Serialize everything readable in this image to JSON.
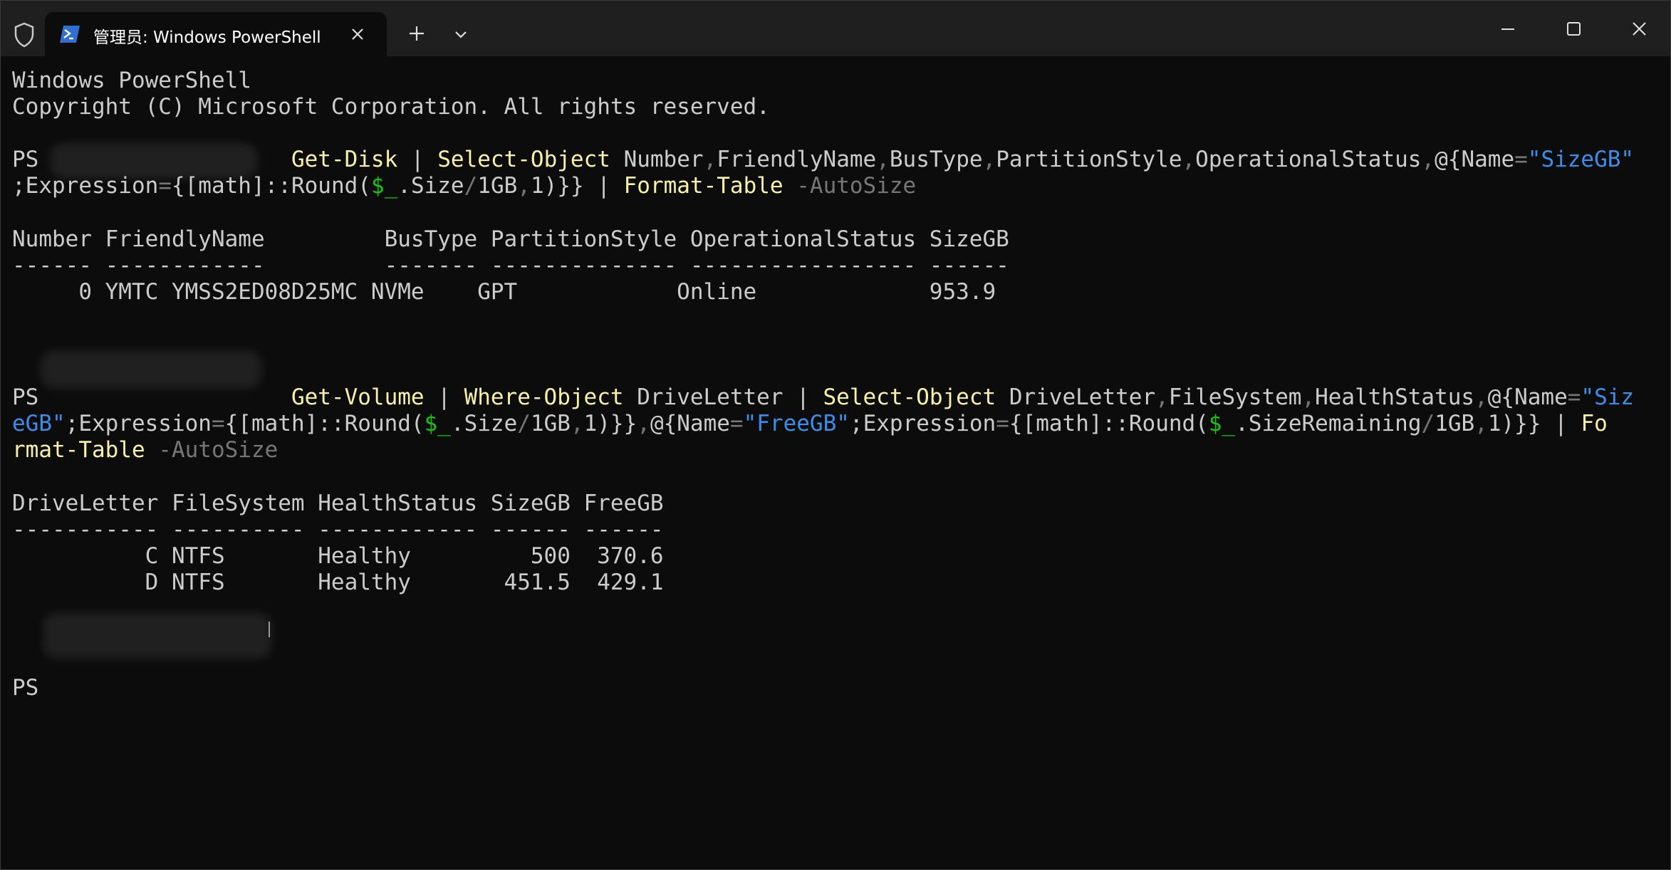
{
  "window": {
    "tab_title": "管理员: Windows PowerShell",
    "icons": {
      "shield": "shield-icon",
      "tab": "powershell-icon",
      "close_tab": "close-icon",
      "new_tab": "plus-icon",
      "dropdown": "chevron-down-icon",
      "minimize": "minimize-icon",
      "maximize": "maximize-icon",
      "close_window": "close-icon"
    }
  },
  "console": {
    "header_line1": "Windows PowerShell",
    "header_line2": "Copyright (C) Microsoft Corporation. All rights reserved.",
    "cmd1": {
      "prompt": "PS ",
      "a": "Get-Disk",
      "b": " | ",
      "c": "Select-Object",
      "d": " Number",
      "e": ",",
      "f": "FriendlyName",
      "g": ",",
      "h": "BusType",
      "i": ",",
      "j": "PartitionStyle",
      "k": ",",
      "l": "OperationalStatus",
      "m": ",",
      "n": "@{Name",
      "o": "=",
      "p": "\"SizeGB\"",
      "q": ";Expression",
      "r": "=",
      "s": "{[math]::Round(",
      "t": "$_",
      "u": ".Size",
      "v": "/",
      "w": "1GB",
      "x": ",",
      "y": "1)}} | ",
      "z": "Format-Table",
      "aa": " -AutoSize"
    },
    "disk_table": {
      "header": "Number FriendlyName         BusType PartitionStyle OperationalStatus SizeGB",
      "sep": "------ ------------         ------- -------------- ----------------- ------",
      "row": "     0 YMTC YMSS2ED08D25MC NVMe    GPT            Online             953.9"
    },
    "cmd2": {
      "prompt": "PS",
      "a": "Get-Volume",
      "b": " | ",
      "c": "Where-Object",
      "d": " DriveLetter | ",
      "e": "Select-Object",
      "f": " DriveLetter",
      "g": ",",
      "h": "FileSystem",
      "i": ",",
      "j": "HealthStatus",
      "k": ",",
      "l": "@{Name",
      "m": "=",
      "n": "\"Siz",
      "o": "eGB\"",
      "p": ";Expression",
      "q": "=",
      "r": "{[math]::Round(",
      "s": "$_",
      "t": ".Size",
      "u": "/",
      "v": "1GB",
      "w": ",",
      "x": "1)}}",
      "y": ",",
      "z": "@{Name",
      "aa": "=",
      "ab": "\"FreeGB\"",
      "ac": ";Expression",
      "ad": "=",
      "ae": "{[math]::Round(",
      "af": "$_",
      "ag": ".SizeRemaining",
      "ah": "/",
      "ai": "1GB",
      "aj": ",",
      "ak": "1)}} | ",
      "al": "Fo",
      "am": "rmat-Table",
      "an": " -AutoSize"
    },
    "volume_table": {
      "header": "DriveLetter FileSystem HealthStatus SizeGB FreeGB",
      "sep": "----------- ---------- ------------ ------ ------",
      "row1": "          C NTFS       Healthy         500  370.6",
      "row2": "          D NTFS       Healthy       451.5  429.1"
    },
    "prompt3": "PS"
  }
}
